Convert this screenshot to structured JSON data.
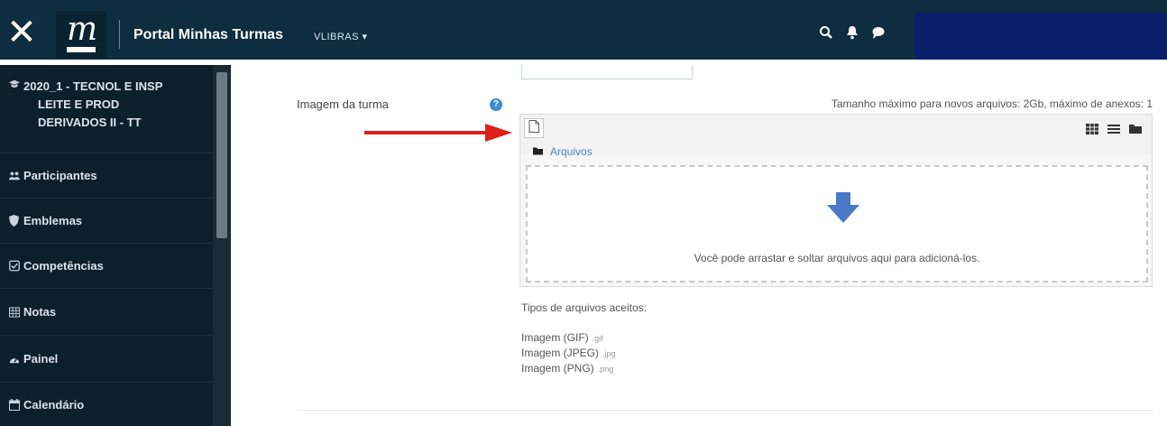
{
  "topbar": {
    "close_glyph": "✕",
    "logo_letter": "m",
    "title": "Portal Minhas Turmas",
    "user": "VLIBRAS ▾",
    "icons": [
      "search-icon",
      "bell-icon",
      "chat-icon"
    ]
  },
  "sidebar": {
    "items": [
      {
        "label_lines": [
          "2020_1 - TECNOL E INSP",
          "LEITE E PROD",
          "DERIVADOS II - TT"
        ],
        "icon": "graduation-cap-icon"
      },
      {
        "label": "Participantes",
        "icon": "users-icon"
      },
      {
        "label": "Emblemas",
        "icon": "shield-icon"
      },
      {
        "label": "Competências",
        "icon": "check-square-icon"
      },
      {
        "label": "Notas",
        "icon": "table-icon"
      },
      {
        "label": "Painel",
        "icon": "dashboard-icon"
      },
      {
        "label": "Calendário",
        "icon": "calendar-icon"
      }
    ]
  },
  "main": {
    "field_label": "Imagem da turma",
    "max_size": "Tamanho máximo para novos arquivos: 2Gb, máximo de anexos: 1",
    "filemanager": {
      "path_label": "Arquivos",
      "drop_text": "Você pode arrastar e soltar arquivos aqui para adicioná-los."
    },
    "accepted_title": "Tipos de arquivos aceitos:",
    "accepted_types": [
      {
        "name": "Imagem (GIF)",
        "ext": ".gif"
      },
      {
        "name": "Imagem (JPEG)",
        "ext": ".jpg"
      },
      {
        "name": "Imagem (PNG)",
        "ext": ".png"
      }
    ]
  },
  "colors": {
    "topbar": "#0e2d3e",
    "sidebar": "#0e1f2c",
    "link": "#4a86c6",
    "annotation_arrow": "#e0201a",
    "drop_arrow": "#4a79c8"
  }
}
